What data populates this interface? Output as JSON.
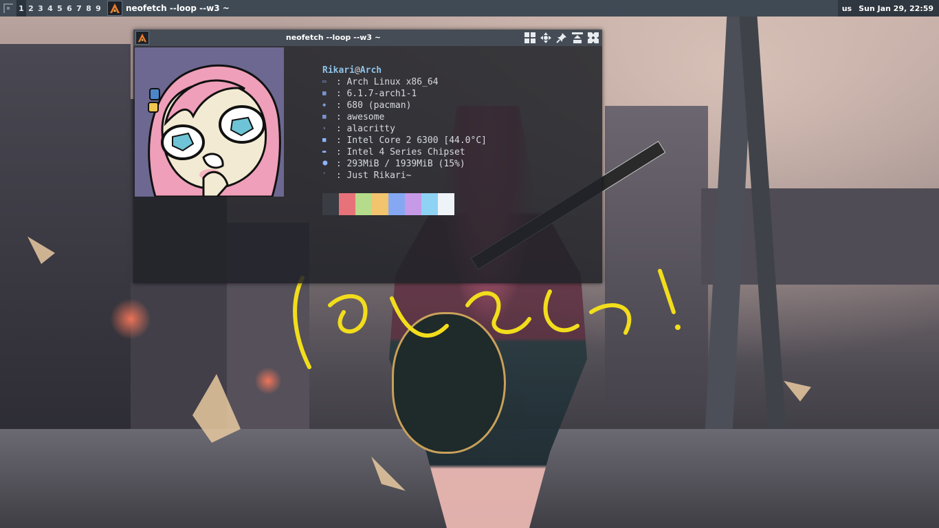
{
  "topbar": {
    "tags": [
      "1",
      "2",
      "3",
      "4",
      "5",
      "6",
      "7",
      "8",
      "9"
    ],
    "active_tag": "1",
    "task_title": "neofetch --loop --w3 ~",
    "keyboard_layout": "us",
    "clock": "Sun Jan 29, 22:59"
  },
  "window": {
    "title": "neofetch --loop --w3 ~",
    "controls": [
      "layout-icon",
      "move-icon",
      "pin-icon",
      "maximize-icon",
      "close-icon"
    ]
  },
  "neofetch": {
    "user": "Rikari",
    "at": "@",
    "host": "Arch",
    "sep": " : ",
    "lines": [
      {
        "icon": "desktop-icon",
        "glyph": "▭",
        "value": "Arch Linux x86_64"
      },
      {
        "icon": "kernel-icon",
        "glyph": "▦",
        "value": "6.1.7-arch1-1"
      },
      {
        "icon": "package-icon",
        "glyph": "◈",
        "value": "680 (pacman)"
      },
      {
        "icon": "wm-icon",
        "glyph": "▦",
        "value": "awesome"
      },
      {
        "icon": "terminal-icon",
        "glyph": "›",
        "value": "alacritty"
      },
      {
        "icon": "cpu-icon",
        "glyph": "■",
        "value": "Intel Core 2 6300 [44.0°C]"
      },
      {
        "icon": "gpu-icon",
        "glyph": "▬",
        "value": "Intel 4 Series Chipset"
      },
      {
        "icon": "memory-icon",
        "glyph": "⬢",
        "value": "293MiB / 1939MiB (15%)"
      },
      {
        "icon": "quote-icon",
        "glyph": "'",
        "value": "Just Rikari~"
      }
    ],
    "palette": [
      "#3a3d44",
      "#e8727a",
      "#b5dc8a",
      "#f2c46d",
      "#86a8f2",
      "#c79ae8",
      "#8fd3f4",
      "#eef3f7"
    ]
  }
}
